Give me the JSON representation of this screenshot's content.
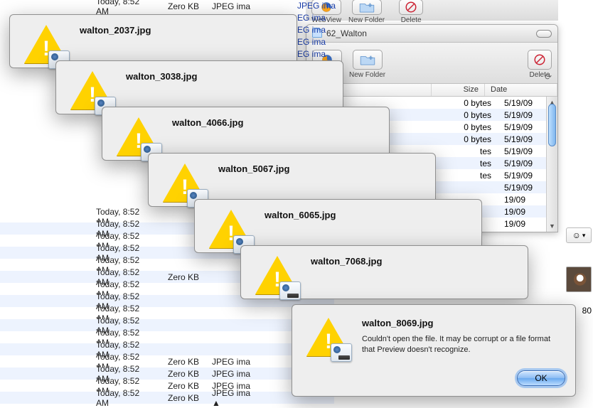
{
  "top_toolbar": {
    "webview": "WebView",
    "newfolder": "New Folder",
    "delete": "Delete"
  },
  "finder2": {
    "title": "62_Walton",
    "webview": "WebView",
    "newfolder": "New Folder",
    "delete": "Delete",
    "col_size": "Size",
    "col_date": "Date",
    "rows": [
      {
        "size": "0 bytes",
        "date": "5/19/09"
      },
      {
        "size": "0 bytes",
        "date": "5/19/09"
      },
      {
        "size": "0 bytes",
        "date": "5/19/09"
      },
      {
        "size": "0 bytes",
        "date": "5/19/09"
      },
      {
        "size": "tes",
        "date": "5/19/09"
      },
      {
        "size": "tes",
        "date": "5/19/09"
      },
      {
        "size": "tes",
        "date": "5/19/09"
      },
      {
        "size": "",
        "date": "5/19/09"
      },
      {
        "size": "",
        "date": "19/09"
      },
      {
        "size": "",
        "date": "19/09"
      },
      {
        "size": "",
        "date": "19/09"
      }
    ]
  },
  "bg_header": {
    "date": "Today, 8:52 AM",
    "size": "Zero KB",
    "kind": "JPEG ima"
  },
  "bg_list_dates": [
    "Today, 8:52 AM",
    "Today, 8:52 AM",
    "Today, 8:52 AM",
    "Today, 8:52 AM",
    "Today, 8:52 AM",
    "Today, 8:52 AM",
    "Today, 8:52 AM",
    "Today, 8:52 AM",
    "Today, 8:52 AM",
    "Today, 8:52 AM",
    "Today, 8:52 AM",
    "Today, 8:52 AM",
    "Today, 8:52 AM",
    "Today, 8:52 AM",
    "Today, 8:52 AM",
    "Today, 8:52 AM"
  ],
  "bg_list_sizes": [
    "",
    "",
    "",
    "",
    "",
    "Zero KB",
    "",
    "",
    "",
    "",
    "",
    "",
    "Zero KB",
    "Zero KB",
    "Zero KB",
    "Zero KB"
  ],
  "bg_list_kinds_last": [
    "JPEG ima",
    "JPEG ima",
    "JPEG ima",
    "JPEG ima ▲"
  ],
  "kind_fragment": [
    "JPEG ima",
    "EG ima",
    "EG ima",
    "EG ima",
    "EG ima"
  ],
  "dialogs": [
    {
      "file": "walton_2037.jpg"
    },
    {
      "file": "walton_3038.jpg"
    },
    {
      "file": "walton_4066.jpg"
    },
    {
      "file": "walton_5067.jpg"
    },
    {
      "file": "walton_6065.jpg"
    },
    {
      "file": "walton_7068.jpg"
    }
  ],
  "front_dialog": {
    "file": "walton_8069.jpg",
    "body": "Couldn't open the file. It may be corrupt or a file format that Preview doesn't recognize.",
    "ok": "OK"
  },
  "smiley": "☺",
  "partial_text_right": "80"
}
